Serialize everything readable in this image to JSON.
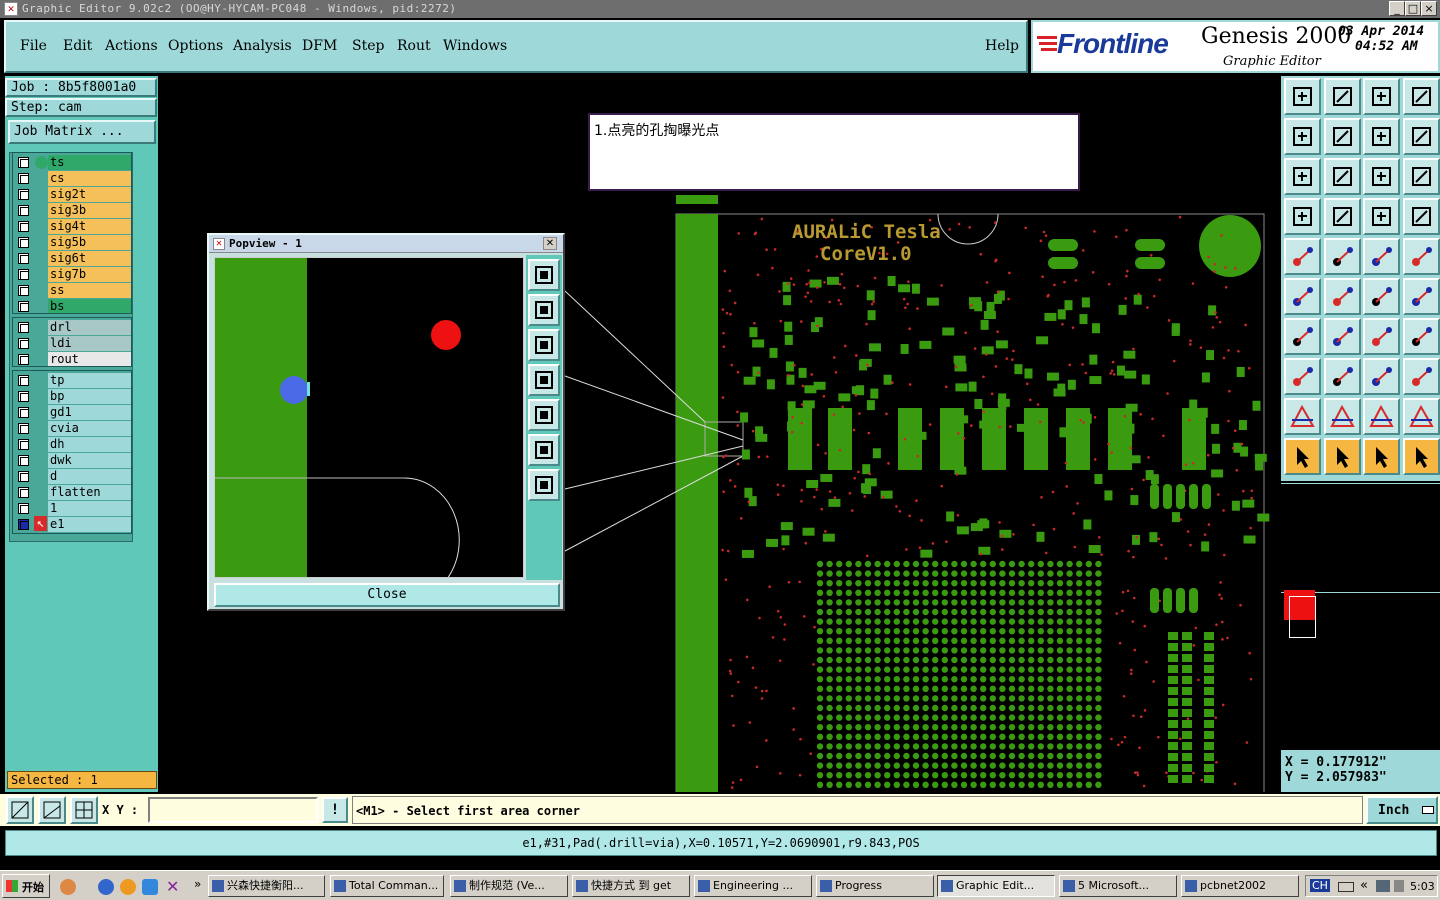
{
  "window": {
    "title": "Graphic Editor 9.02c2 (OO@HY-HYCAM-PC048 - Windows, pid:2272)",
    "controls": [
      "_",
      "□",
      "×"
    ]
  },
  "menu": {
    "items": [
      "File",
      "Edit",
      "Actions",
      "Options",
      "Analysis",
      "DFM",
      "Step",
      "Rout",
      "Windows"
    ],
    "help": "Help"
  },
  "brand": {
    "logo": "Frontline",
    "product": "Genesis 2000",
    "subtitle": "Graphic Editor",
    "date": "03 Apr 2014",
    "time": "04:52 AM"
  },
  "job": {
    "job_line": "Job : 8b5f8001a0",
    "step_line": "Step: cam",
    "matrix_button": "Job Matrix ..."
  },
  "layers": {
    "group1": [
      {
        "name": "ts",
        "color": "#2fa86a"
      },
      {
        "name": "cs",
        "color": "#f5c05a"
      },
      {
        "name": "sig2t",
        "color": "#f5c05a"
      },
      {
        "name": "sig3b",
        "color": "#f5c05a"
      },
      {
        "name": "sig4t",
        "color": "#f5c05a"
      },
      {
        "name": "sig5b",
        "color": "#f5c05a"
      },
      {
        "name": "sig6t",
        "color": "#f5c05a"
      },
      {
        "name": "sig7b",
        "color": "#f5c05a"
      },
      {
        "name": "ss",
        "color": "#f5c05a"
      },
      {
        "name": "bs",
        "color": "#2fa86a"
      }
    ],
    "group2": [
      {
        "name": "drl",
        "color": "#a8c8c8"
      },
      {
        "name": "ldi",
        "color": "#a8c8c8"
      },
      {
        "name": "rout",
        "color": "#e8e8e8"
      }
    ],
    "group3": [
      {
        "name": "tp",
        "color": "#9ed8d8"
      },
      {
        "name": "bp",
        "color": "#9ed8d8"
      },
      {
        "name": "gd1",
        "color": "#9ed8d8"
      },
      {
        "name": "cvia",
        "color": "#9ed8d8"
      },
      {
        "name": "dh",
        "color": "#9ed8d8"
      },
      {
        "name": "dwk",
        "color": "#9ed8d8"
      },
      {
        "name": "d",
        "color": "#9ed8d8"
      },
      {
        "name": "flatten",
        "color": "#9ed8d8"
      },
      {
        "name": "1",
        "color": "#9ed8d8"
      },
      {
        "name": "e1",
        "color": "#9ed8d8"
      }
    ]
  },
  "selected": "Selected : 1",
  "note": {
    "text": "1.点亮的孔掏曝光点"
  },
  "board": {
    "silk_line1": "AURALiC Tesla",
    "silk_line2": "CoreV1.0"
  },
  "popview": {
    "title": "Popview - 1",
    "close_label": "Close"
  },
  "coords": {
    "x": "X = 0.177912\"",
    "y": "Y = 2.057983\""
  },
  "command": {
    "xy_label": "X Y :",
    "input_value": "",
    "bang": "!",
    "prompt": "<M1> - Select first area corner",
    "units": "Inch"
  },
  "status": {
    "text": "e1,#31,Pad(.drill=via),X=0.10571,Y=2.0690901,r9.843,POS"
  },
  "taskbar": {
    "start": "开始",
    "tasks": [
      "兴森快捷衡阳...",
      "Total Comman...",
      "制作规范 (Ve...",
      "快捷方式 到 get",
      "Engineering ...",
      "Progress",
      "Graphic Edit...",
      "5 Microsoft...",
      "pcbnet2002"
    ],
    "lang": "CH",
    "clock": "5:03"
  }
}
